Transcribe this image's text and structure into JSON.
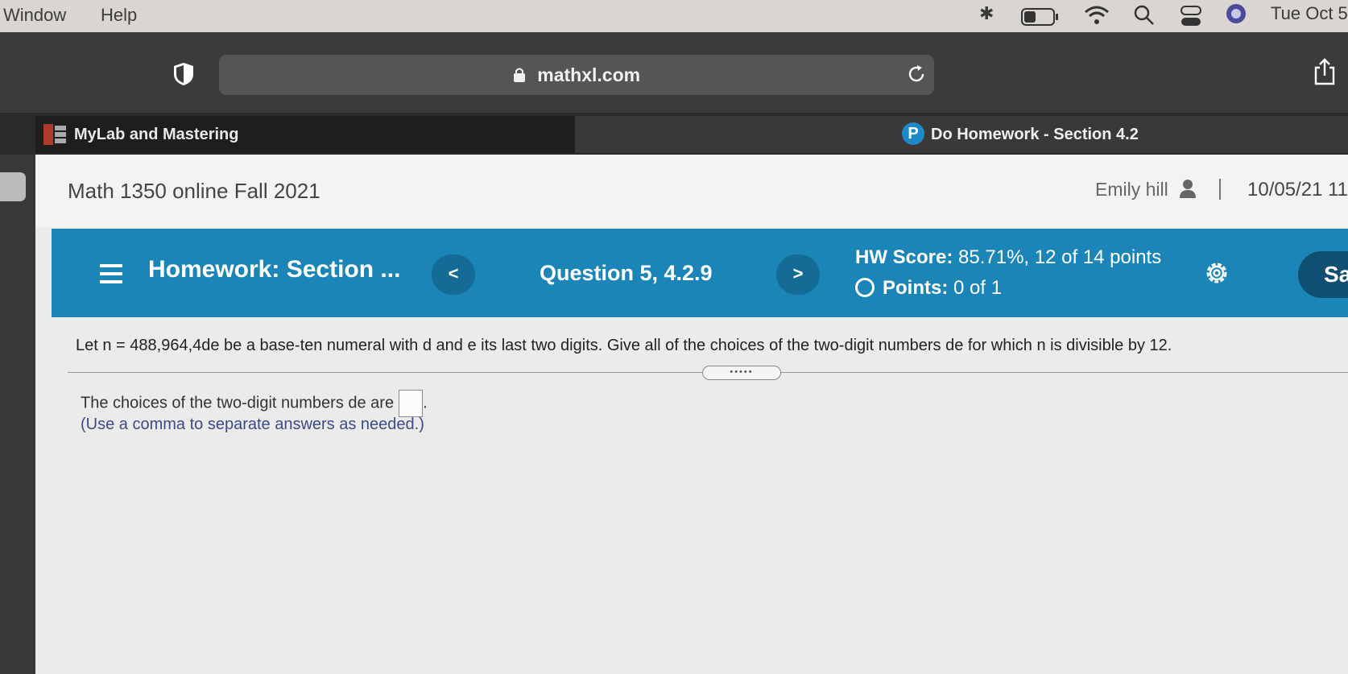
{
  "menubar": {
    "window": "Window",
    "help": "Help",
    "clock": "Tue Oct 5"
  },
  "browser": {
    "url": "mathxl.com",
    "tabs": [
      {
        "label": "MyLab and Mastering"
      },
      {
        "label": "Do Homework - Section 4.2",
        "icon": "P"
      }
    ]
  },
  "header": {
    "course": "Math 1350 online Fall 2021",
    "user": "Emily hill",
    "separator": "|",
    "datetime": "10/05/21 11"
  },
  "homework_bar": {
    "title_prefix": "Homework:",
    "title": "Section ...",
    "prev": "<",
    "next": ">",
    "question": "Question 5, 4.2.9",
    "hw_score_label": "HW Score:",
    "hw_score_value": "85.71%, 12 of 14 points",
    "points_label": "Points:",
    "points_value": "0 of 1",
    "save_label": "Sa"
  },
  "question": {
    "text": "Let n = 488,964,4de be a base-ten numeral with d and e its last two digits. Give all of the choices of the two-digit numbers de for which n is divisible by 12.",
    "drag_handle": "•••••",
    "answer_prompt": "The choices of the two-digit numbers de are",
    "answer_value": "",
    "answer_suffix": ".",
    "instructions": "(Use a comma to separate answers as needed.)"
  },
  "colors": {
    "accent": "#1a85b6",
    "accent_dark": "#146c96"
  }
}
